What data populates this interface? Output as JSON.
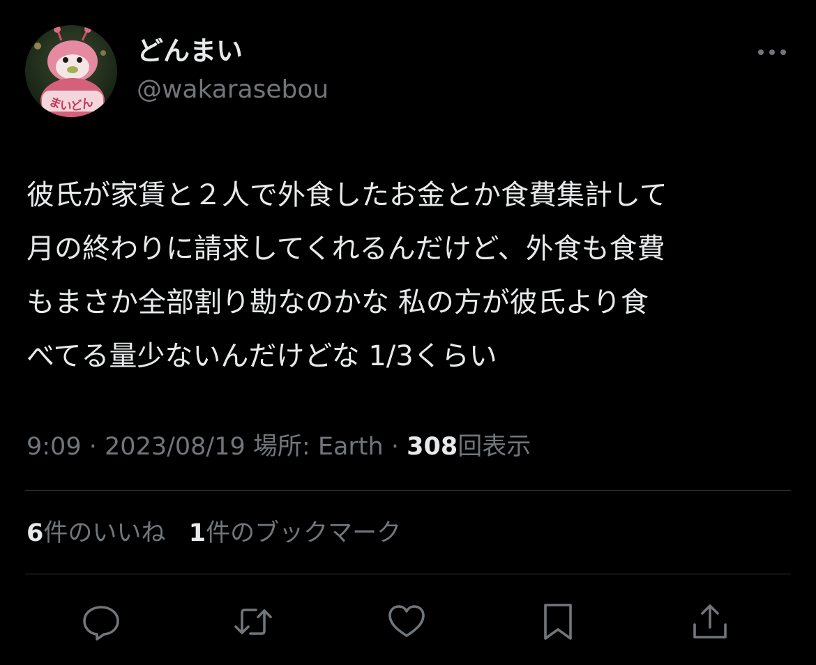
{
  "author": {
    "display_name": "どんまい",
    "handle": "@wakarasebou",
    "avatar_text": "まいどん",
    "avatar_icon": "pink-mascot-avatar"
  },
  "tweet": {
    "lines": [
      "彼氏が家賃と２人で外食したお金とか食費集計して",
      "月の終わりに請求してくれるんだけど、外食も食費",
      "もまさか全部割り勘なのかな 私の方が彼氏より食",
      "べてる量少ないんだけどな 1/3くらい"
    ]
  },
  "meta": {
    "time": "9:09",
    "separator": "·",
    "date": "2023/08/19",
    "location_label": "場所:",
    "location": "Earth",
    "views_count": "308",
    "views_label": "回表示"
  },
  "stats": {
    "likes_count": "6",
    "likes_label": "件のいいね",
    "bookmarks_count": "1",
    "bookmarks_label": "件のブックマーク"
  },
  "actions": [
    {
      "name": "reply",
      "icon": "reply-icon"
    },
    {
      "name": "retweet",
      "icon": "retweet-icon"
    },
    {
      "name": "like",
      "icon": "heart-icon"
    },
    {
      "name": "bookmark",
      "icon": "bookmark-icon"
    },
    {
      "name": "share",
      "icon": "share-icon"
    }
  ],
  "colors": {
    "background": "#000000",
    "primary_text": "#e7e9ea",
    "secondary_text": "#71767b",
    "divider": "#2f3336"
  }
}
